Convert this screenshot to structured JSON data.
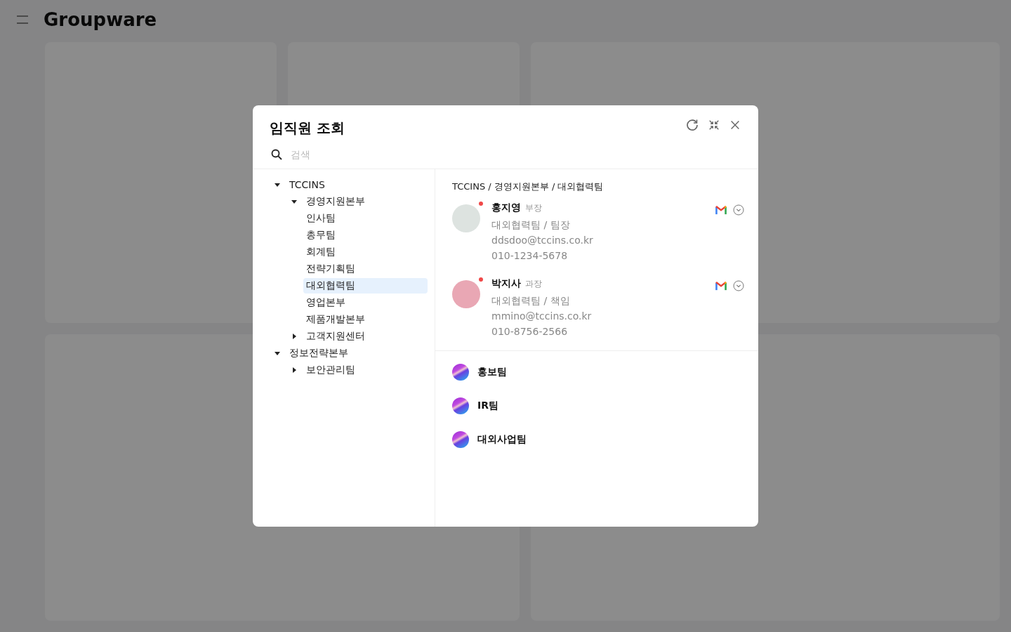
{
  "app": {
    "title": "Groupware"
  },
  "dialog": {
    "title": "임직원 조회",
    "search": {
      "placeholder": "검색"
    },
    "tree": [
      {
        "label": "TCCINS",
        "expanded": true,
        "selected": false,
        "children": [
          {
            "label": "경영지원본부",
            "expanded": true,
            "selected": false,
            "children": [
              {
                "label": "인사팀",
                "selected": false
              },
              {
                "label": "총무팀",
                "selected": false
              },
              {
                "label": "회계팀",
                "selected": false
              },
              {
                "label": "전략기획팀",
                "selected": false
              },
              {
                "label": "대외협력팀",
                "selected": true
              },
              {
                "label": "영업본부",
                "selected": false
              },
              {
                "label": "제품개발본부",
                "selected": false
              }
            ]
          },
          {
            "label": "고객지원센터",
            "expanded": false,
            "selected": false
          }
        ]
      },
      {
        "label": "정보전략본부",
        "expanded": true,
        "selected": false,
        "children": [
          {
            "label": "보안관리팀",
            "expanded": false,
            "selected": false
          }
        ]
      }
    ],
    "breadcrumb": "TCCINS / 경영지원본부 / 대외협력팀",
    "members": [
      {
        "name": "홍지영",
        "rank": "부장",
        "role": "대외협력팀 / 팀장",
        "email": "ddsdoo@tccins.co.kr",
        "phone": "010-1234-5678",
        "status_dot": true
      },
      {
        "name": "박지사",
        "rank": "과장",
        "role": "대외협력팀 / 책임",
        "email": "mmino@tccins.co.kr",
        "phone": "010-8756-2566",
        "status_dot": true
      }
    ],
    "teams": [
      {
        "name": "홍보팀"
      },
      {
        "name": "IR팀"
      },
      {
        "name": "대외사업팀"
      }
    ]
  }
}
